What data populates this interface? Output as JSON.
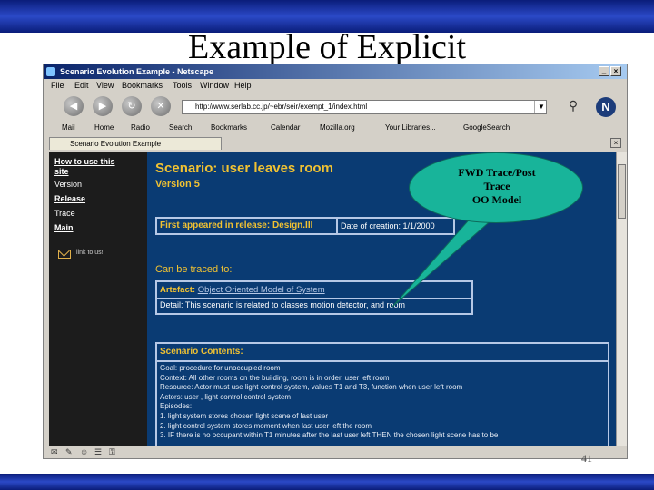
{
  "slide": {
    "title": "Example of Explicit",
    "page_number": "41"
  },
  "browser": {
    "window_title": "Scenario Evolution Example - Netscape",
    "menu": [
      "File",
      "Edit",
      "View",
      "Bookmarks",
      "Tools",
      "Window",
      "Help"
    ],
    "url": "http://www.serlab.cc.jp/~ebr/seir/exempt_1/index.html",
    "bookmarks": [
      "Mail",
      "Home",
      "Radio",
      "Search",
      "Bookmarks",
      "Calendar",
      "Mozilla.org",
      "Your Libraries...",
      "GoogleSearch"
    ],
    "tab_title": "Scenario Evolution Example",
    "status_icons": [
      "mail-status-icon",
      "composer-icon",
      "chat-icon",
      "address-book-icon",
      "security-icon"
    ]
  },
  "page": {
    "sidebar": {
      "how_to_use": "How to use this site",
      "version": "Version",
      "release": "Release",
      "trace": "Trace",
      "main": "Main",
      "mail_label": "link to us!"
    },
    "scenario_title": "Scenario: user leaves room",
    "version": "Version 5",
    "release": {
      "label": "First appeared in release: Design.III",
      "date": "Date of creation: 1/1/2000"
    },
    "traced_heading": "Can be traced to:",
    "artefact": {
      "label": "Artefact:",
      "value": "Object Oriented Model of System",
      "detail": "Detail: This scenario is related to classes motion detector, and room"
    },
    "contents": {
      "heading": "Scenario Contents:",
      "lines": [
        "Goal: procedure for unoccupied room",
        "Context: All other rooms on the building, room is in order, user left room",
        "Resource: Actor must use light control system, values T1 and T3, function when user left room",
        "Actors: user , light control control system",
        "Episodes:",
        "1. light system stores chosen light scene of last user",
        "2. light control system stores moment when last user left the room",
        "3. IF there is no occupant within T1 minutes after the last user left THEN the chosen light scene has to be"
      ]
    }
  },
  "callout": {
    "text_lines": [
      "FWD Trace/Post",
      "Trace",
      "OO Model"
    ],
    "color": "#18b49a"
  }
}
